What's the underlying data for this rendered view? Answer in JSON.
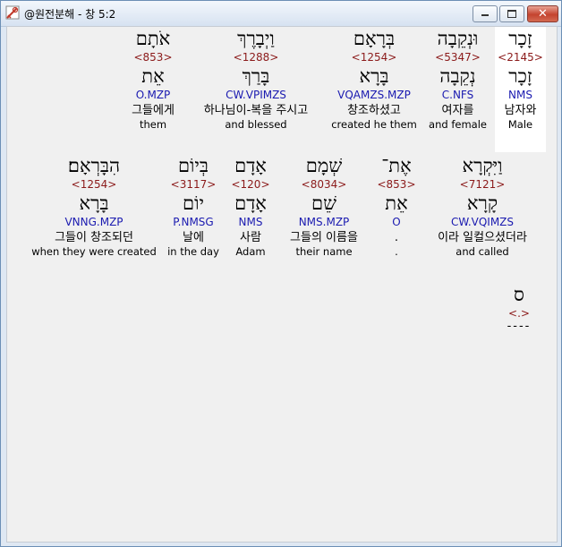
{
  "window": {
    "title": "@원전분해 - 창 5:2",
    "min_glyph": "—",
    "close_glyph": "✕"
  },
  "rows": [
    {
      "words": [
        {
          "hebrew": "זָכָר",
          "strong": "<2145>",
          "lemma": "זָכָר",
          "parse": "NMS",
          "korean": "남자와",
          "english": "Male",
          "selected": true
        },
        {
          "hebrew": "וּנְקֵבָה",
          "strong": "<5347>",
          "lemma": "נְקֵבָה",
          "parse": "C.NFS",
          "korean": "여자를",
          "english": "and female"
        },
        {
          "hebrew": "בְּרָאָם",
          "strong": "<1254>",
          "lemma": "בָּרָא",
          "parse": "VQAMZS.MZP",
          "korean": "창조하셨고",
          "english": "created he them"
        },
        {
          "hebrew": "וַיְבָרֶךְ",
          "strong": "<1288>",
          "lemma": "בָּרַךְ",
          "parse": "CW.VPIMZS",
          "korean": "하나님이-복을 주시고",
          "english": "and blessed"
        },
        {
          "hebrew": "אֹתָם",
          "strong": "<853>",
          "lemma": "אֵת",
          "parse": "O.MZP",
          "korean": "그들에게",
          "english": "them"
        }
      ]
    },
    {
      "words": [
        {
          "hebrew": "וַיִּקְרָא",
          "strong": "<7121>",
          "lemma": "קָרָא",
          "parse": "CW.VQIMZS",
          "korean": "이라 일컬으셨더라",
          "english": "and called"
        },
        {
          "hebrew": "אֶת־",
          "strong": "<853>",
          "lemma": "אֵת",
          "parse": "O",
          "korean": ".",
          "english": "."
        },
        {
          "hebrew": "שְׁמָם",
          "strong": "<8034>",
          "lemma": "שֵׁם",
          "parse": "NMS.MZP",
          "korean": "그들의 이름을",
          "english": "their name"
        },
        {
          "hebrew": "אָדָם",
          "strong": "<120>",
          "lemma": "אָדָם",
          "parse": "NMS",
          "korean": "사람",
          "english": "Adam"
        },
        {
          "hebrew": "בְּיוֹם",
          "strong": "<3117>",
          "lemma": "יוֹם",
          "parse": "P.NMSG",
          "korean": "날에",
          "english": "in the day"
        },
        {
          "hebrew": "הִבָּרְאָם׃",
          "strong": "<1254>",
          "lemma": "בָּרָא",
          "parse": "VNNG.MZP",
          "korean": "그들이 창조되던",
          "english": "when they were created"
        }
      ]
    },
    {
      "words": [
        {
          "hebrew": "ס",
          "strong": "<.>",
          "dashes": "----"
        }
      ]
    }
  ]
}
